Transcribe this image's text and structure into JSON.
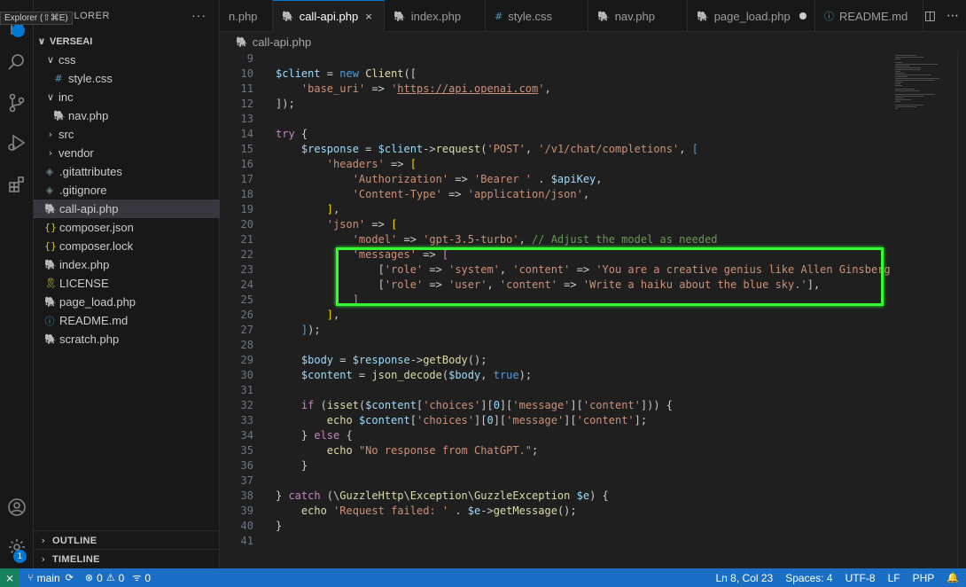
{
  "tooltip": "Explorer (⇧⌘E)",
  "explorer": {
    "title": "EXPLORER",
    "more": "···",
    "root": "VERSEAI",
    "items": [
      {
        "label": "css",
        "chev": "∨",
        "icon": ""
      },
      {
        "label": "style.css",
        "chev": "",
        "icon": "#"
      },
      {
        "label": "inc",
        "chev": "∨",
        "icon": ""
      },
      {
        "label": "nav.php",
        "chev": "",
        "icon": "🐘"
      },
      {
        "label": "src",
        "chev": "›",
        "icon": ""
      },
      {
        "label": "vendor",
        "chev": "›",
        "icon": ""
      },
      {
        "label": ".gitattributes",
        "chev": "",
        "icon": "◈"
      },
      {
        "label": ".gitignore",
        "chev": "",
        "icon": "◈"
      },
      {
        "label": "call-api.php",
        "chev": "",
        "icon": "🐘"
      },
      {
        "label": "composer.json",
        "chev": "",
        "icon": "{}"
      },
      {
        "label": "composer.lock",
        "chev": "",
        "icon": "{}"
      },
      {
        "label": "index.php",
        "chev": "",
        "icon": "🐘"
      },
      {
        "label": "LICENSE",
        "chev": "",
        "icon": "🎗"
      },
      {
        "label": "page_load.php",
        "chev": "",
        "icon": "🐘"
      },
      {
        "label": "README.md",
        "chev": "",
        "icon": "ⓘ"
      },
      {
        "label": "scratch.php",
        "chev": "",
        "icon": "🐘"
      }
    ],
    "outline": "OUTLINE",
    "timeline": "TIMELINE"
  },
  "tabs": [
    {
      "label": "n.php",
      "icon": ""
    },
    {
      "label": "call-api.php",
      "icon": "🐘",
      "close": "×"
    },
    {
      "label": "index.php",
      "icon": "🐘"
    },
    {
      "label": "style.css",
      "icon": "#"
    },
    {
      "label": "nav.php",
      "icon": "🐘"
    },
    {
      "label": "page_load.php",
      "icon": "🐘"
    },
    {
      "label": "README.md",
      "icon": "ⓘ"
    }
  ],
  "breadcrumb": "call-api.php",
  "activity": {
    "source_control_badge": "1",
    "settings_badge": "1"
  },
  "code_lines": [
    {
      "n": "9",
      "h": ""
    },
    {
      "n": "10",
      "h": "<span class='v'>$client</span> = <span class='k'>new</span> <span class='f'>Client</span>(["
    },
    {
      "n": "11",
      "h": "    <span class='s'>'base_uri'</span> => <span class='s'>'</span><span class='u'>https://api.openai.com</span><span class='s'>'</span>,"
    },
    {
      "n": "12",
      "h": "]);"
    },
    {
      "n": "13",
      "h": ""
    },
    {
      "n": "14",
      "h": "<span class='kc'>try</span> {"
    },
    {
      "n": "15",
      "h": "    <span class='v'>$response</span> = <span class='v'>$client</span>-><span class='f'>request</span>(<span class='s'>'POST'</span>, <span class='s'>'/v1/chat/completions'</span>, <span class='k'>[</span>"
    },
    {
      "n": "16",
      "h": "        <span class='s'>'headers'</span> => <span class='p'>[</span>"
    },
    {
      "n": "17",
      "h": "            <span class='s'>'Authorization'</span> => <span class='s'>'Bearer '</span> . <span class='v'>$apiKey</span>,"
    },
    {
      "n": "18",
      "h": "            <span class='s'>'Content-Type'</span> => <span class='s'>'application/json'</span>,"
    },
    {
      "n": "19",
      "h": "        <span class='p'>]</span>,"
    },
    {
      "n": "20",
      "h": "        <span class='s'>'json'</span> => <span class='p'>[</span>"
    },
    {
      "n": "21",
      "h": "            <span class='s'>'model'</span> => <span class='s'>'gpt-3.5-turbo'</span>, <span class='c'>// Adjust the model as needed</span>"
    },
    {
      "n": "22",
      "h": "            <span class='s'>'messages'</span> => <span class='kc'>[</span>"
    },
    {
      "n": "23",
      "h": "                [<span class='s'>'role'</span> => <span class='s'>'system'</span>, <span class='s'>'content'</span> => <span class='s'>'You are a creative genius like Allen Ginsberg.'</span>],"
    },
    {
      "n": "24",
      "h": "                [<span class='s'>'role'</span> => <span class='s'>'user'</span>, <span class='s'>'content'</span> => <span class='s'>'Write a haiku about the blue sky.'</span>],"
    },
    {
      "n": "25",
      "h": "            <span class='kc'>]</span>"
    },
    {
      "n": "26",
      "h": "        <span class='p'>]</span>,"
    },
    {
      "n": "27",
      "h": "    <span class='k'>]</span>);"
    },
    {
      "n": "28",
      "h": ""
    },
    {
      "n": "29",
      "h": "    <span class='v'>$body</span> = <span class='v'>$response</span>-><span class='f'>getBody</span>();"
    },
    {
      "n": "30",
      "h": "    <span class='v'>$content</span> = <span class='f'>json_decode</span>(<span class='v'>$body</span>, <span class='k'>true</span>);"
    },
    {
      "n": "31",
      "h": ""
    },
    {
      "n": "32",
      "h": "    <span class='kc'>if</span> (<span class='f'>isset</span>(<span class='v'>$content</span>[<span class='s'>'choices'</span>][<span class='v'>0</span>][<span class='s'>'message'</span>][<span class='s'>'content'</span>])) {"
    },
    {
      "n": "33",
      "h": "        <span class='f'>echo</span> <span class='v'>$content</span>[<span class='s'>'choices'</span>][<span class='v'>0</span>][<span class='s'>'message'</span>][<span class='s'>'content'</span>];"
    },
    {
      "n": "34",
      "h": "    } <span class='kc'>else</span> {"
    },
    {
      "n": "35",
      "h": "        <span class='f'>echo</span> <span class='s'>\"No response from ChatGPT.\"</span>;"
    },
    {
      "n": "36",
      "h": "    }"
    },
    {
      "n": "37",
      "h": ""
    },
    {
      "n": "38",
      "h": "} <span class='kc'>catch</span> (\\<span class='f'>GuzzleHttp</span>\\<span class='f'>Exception</span>\\<span class='f'>GuzzleException</span> <span class='v'>$e</span>) {"
    },
    {
      "n": "39",
      "h": "    <span class='f'>echo</span> <span class='s'>'Request failed: '</span> . <span class='v'>$e</span>-><span class='f'>getMessage</span>();"
    },
    {
      "n": "40",
      "h": "}"
    },
    {
      "n": "41",
      "h": ""
    }
  ],
  "status": {
    "remote": "⨯",
    "branch": "main",
    "errors": "0",
    "warnings": "0",
    "ports": "0",
    "position": "Ln 8, Col 23",
    "spaces": "Spaces: 4",
    "encoding": "UTF-8",
    "eol": "LF",
    "language": "PHP"
  },
  "colors": {
    "accent": "#0078d4",
    "statusbar": "#1a6fc4",
    "highlight": "#33ff33",
    "php_icon": "#a074c4"
  }
}
